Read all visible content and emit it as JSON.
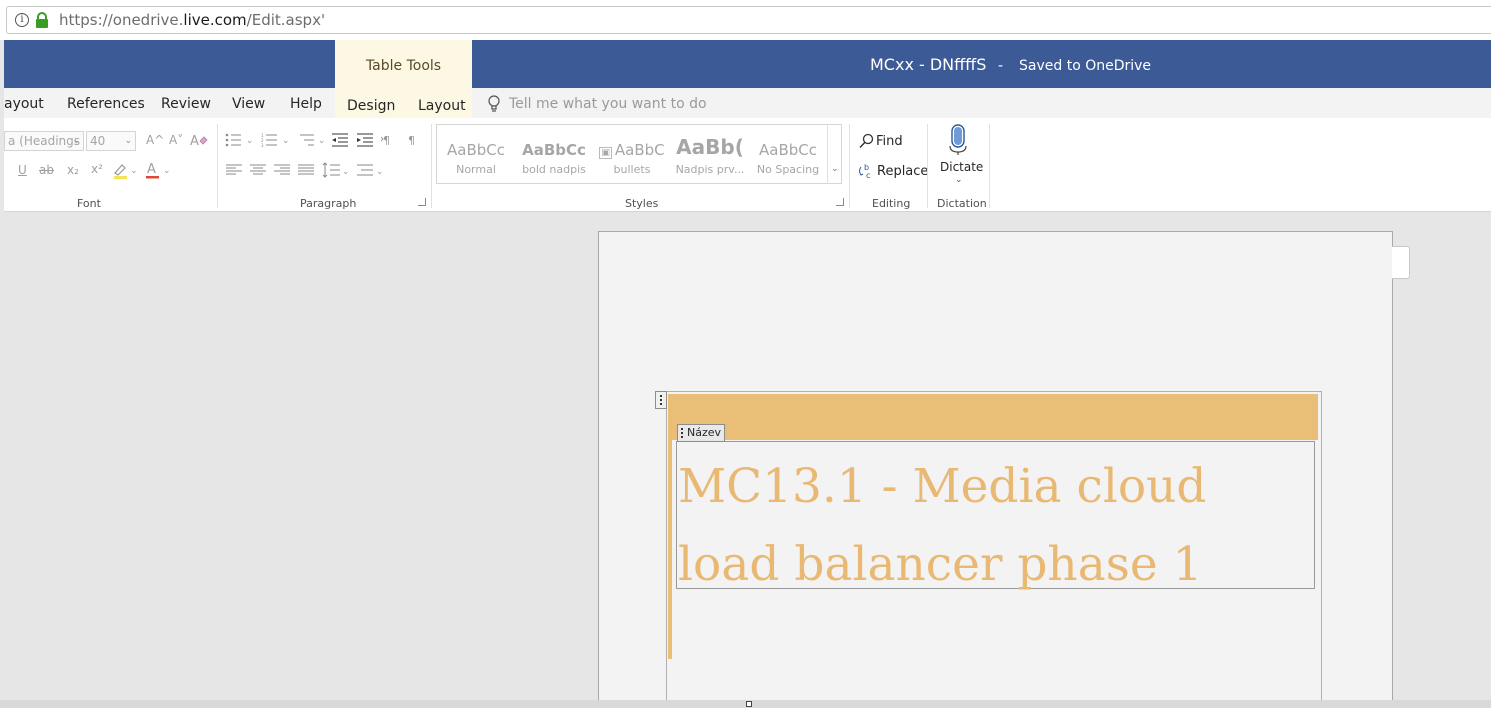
{
  "browser": {
    "url_prefix": "https://onedrive.",
    "url_domain": "live.com",
    "url_suffix": "/Edit.aspx'"
  },
  "titlebar": {
    "contextual_group": "Table Tools",
    "doc_name": "MCxx - DNffffS",
    "separator": "-",
    "save_status": "Saved to OneDrive"
  },
  "tabs": {
    "layout": "ayout",
    "references": "References",
    "review": "Review",
    "view": "View",
    "help": "Help",
    "design": "Design",
    "table_layout": "Layout",
    "tell_me": "Tell me what you want to do"
  },
  "font_group": {
    "font_name": "a (Headings",
    "font_size": "40",
    "grow": "A^",
    "shrink": "A˅",
    "underline": "U",
    "strike": "ab",
    "subscript": "x₂",
    "superscript": "x²",
    "font_color": "A",
    "label": "Font"
  },
  "paragraph_group": {
    "label": "Paragraph"
  },
  "styles": {
    "label": "Styles",
    "items": [
      {
        "preview": "AaBbCc",
        "name": "Normal"
      },
      {
        "preview": "AaBbCc",
        "name": "bold nadpis"
      },
      {
        "preview": "AaBbC",
        "name": "bullets"
      },
      {
        "preview": "AaBb(",
        "name": "Nadpis prv..."
      },
      {
        "preview": "AaBbCc",
        "name": "No Spacing"
      }
    ]
  },
  "editing": {
    "find": "Find",
    "replace": "Replace",
    "label": "Editing"
  },
  "dictation": {
    "dictate": "Dictate",
    "label": "Dictation"
  },
  "document": {
    "content_control_tag": "Název",
    "heading": "MC13.1 - Media cloud load balancer phase 1"
  },
  "colors": {
    "titlebar": "#3c5a96",
    "table_tools": "#fcf8e3",
    "accent_orange": "#e9bf78",
    "heading_text": "#e9b873"
  }
}
